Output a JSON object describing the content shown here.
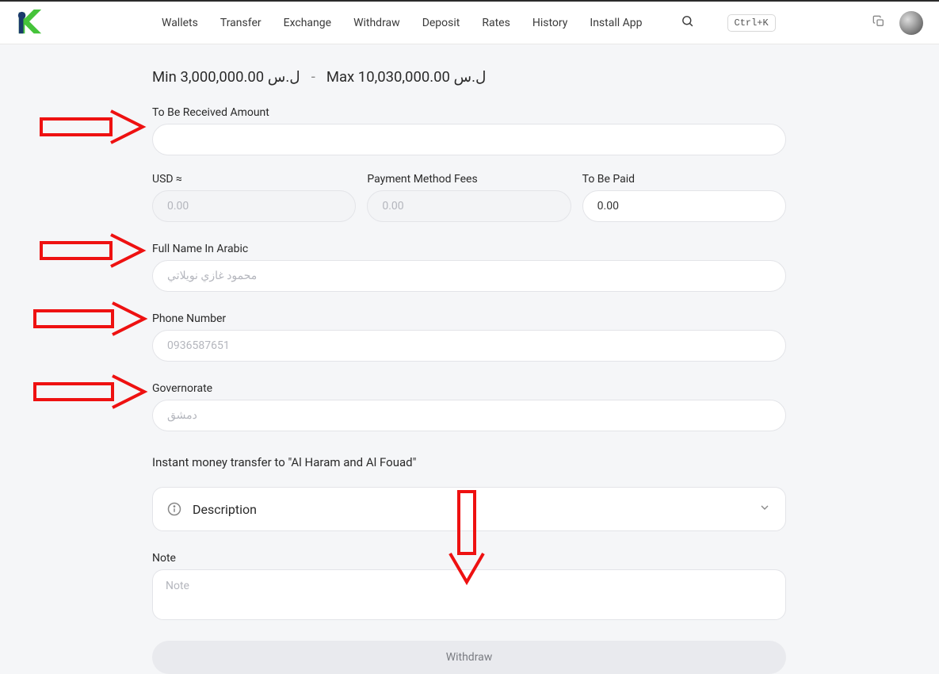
{
  "nav": {
    "items": [
      "Wallets",
      "Transfer",
      "Exchange",
      "Withdraw",
      "Deposit",
      "Rates",
      "History",
      "Install App"
    ],
    "shortcut": "Ctrl+K"
  },
  "limits": {
    "min_label": "Min 3,000,000.00 ل.س",
    "max_label": "Max 10,030,000.00 ل.س"
  },
  "form": {
    "received_label": "To Be Received Amount",
    "usd_label": "USD ≈",
    "usd_placeholder": "0.00",
    "fees_label": "Payment Method Fees",
    "fees_placeholder": "0.00",
    "paid_label": "To Be Paid",
    "paid_value": "0.00",
    "fullname_label": "Full Name In Arabic",
    "fullname_placeholder": "محمود غازي نويلاتي",
    "phone_label": "Phone Number",
    "phone_placeholder": "0936587651",
    "governorate_label": "Governorate",
    "governorate_placeholder": "دمشق",
    "info_line": "Instant money transfer to \"Al Haram and Al Fouad\"",
    "accordion_label": "Description",
    "note_label": "Note",
    "note_placeholder": "Note",
    "submit_label": "Withdraw"
  }
}
